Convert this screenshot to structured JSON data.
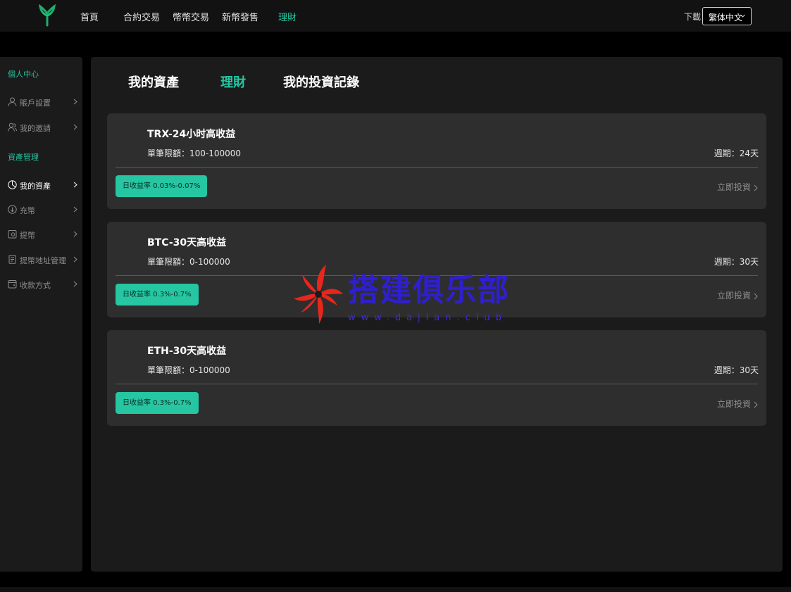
{
  "header": {
    "nav": [
      {
        "label": "首頁",
        "active": false
      },
      {
        "label": "合約交易",
        "active": false
      },
      {
        "label": "幣幣交易",
        "active": false
      },
      {
        "label": "新幣發售",
        "active": false
      },
      {
        "label": "理財",
        "active": true
      }
    ],
    "download_label": "下載",
    "language": "繁体中文"
  },
  "sidebar": {
    "groups": [
      {
        "title": "個人中心"
      },
      {
        "title": "資產管理"
      }
    ],
    "items": [
      {
        "label": "賬戶設置",
        "icon": "user-icon"
      },
      {
        "label": "我的邀請",
        "icon": "users-icon"
      },
      {
        "label": "我的資產",
        "icon": "pie-chart-icon",
        "active": true
      },
      {
        "label": "充幣",
        "icon": "deposit-icon"
      },
      {
        "label": "提幣",
        "icon": "withdraw-icon"
      },
      {
        "label": "提幣地址管理",
        "icon": "address-icon"
      },
      {
        "label": "收款方式",
        "icon": "wallet-icon"
      }
    ]
  },
  "main": {
    "tabs": [
      {
        "label": "我的資產",
        "active": false
      },
      {
        "label": "理財",
        "active": true
      },
      {
        "label": "我的投資記錄",
        "active": false
      }
    ],
    "products": [
      {
        "title": "TRX-24小时高收益",
        "limit": "單筆限額：100-100000",
        "period": "週期：24天",
        "rate": "日收益率 0.03%-0.07%",
        "action": "立即投資"
      },
      {
        "title": "BTC-30天高收益",
        "limit": "單筆限額：0-100000",
        "period": "週期：30天",
        "rate": "日收益率 0.3%-0.7%",
        "action": "立即投資"
      },
      {
        "title": "ETH-30天高收益",
        "limit": "單筆限額：0-100000",
        "period": "週期：30天",
        "rate": "日收益率 0.3%-0.7%",
        "action": "立即投資"
      }
    ]
  },
  "watermark": {
    "text": "搭建俱乐部",
    "url": "www.dajian.club"
  },
  "colors": {
    "accent": "#26c6a2",
    "background": "#000000",
    "panel": "#1b1b1b",
    "card": "#2e2e2f"
  }
}
